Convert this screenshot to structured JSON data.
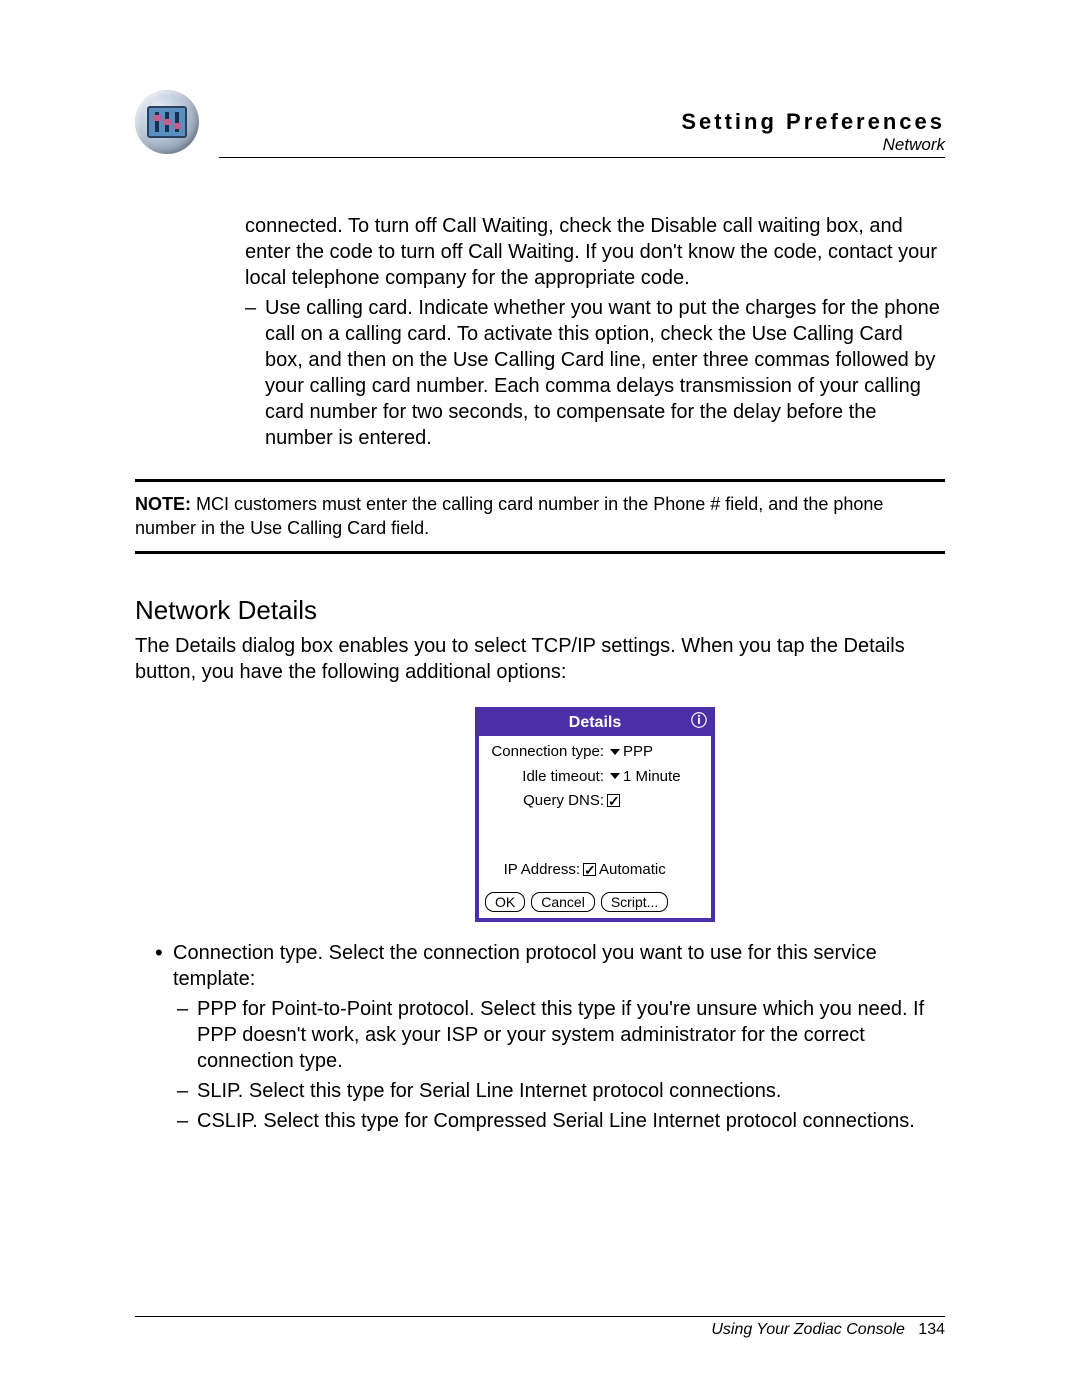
{
  "header": {
    "title": "Setting Preferences",
    "subtitle": "Network"
  },
  "body": {
    "para1": "connected. To turn off Call Waiting, check the Disable call waiting box, and enter the code to turn off Call Waiting. If you don't know the code, contact your local telephone company for the appropriate code.",
    "dash1": "Use calling card. Indicate whether you want to put the charges for the phone call on a calling card. To activate this option, check the Use Calling Card box, and then on the Use Calling Card line, enter three commas followed by your calling card number. Each comma delays transmission of your calling card number for two seconds, to compensate for the delay before the number is entered."
  },
  "note": {
    "label": "NOTE:",
    "text": "MCI customers must enter the calling card number in the Phone # field, and the phone number in the Use Calling Card field."
  },
  "section": {
    "heading": "Network Details",
    "intro": "The Details dialog box enables you to select TCP/IP settings. When you tap the Details button, you have the following additional options:"
  },
  "dialog": {
    "title": "Details",
    "conn_label": "Connection type:",
    "conn_value": "PPP",
    "idle_label": "Idle timeout:",
    "idle_value": "1 Minute",
    "dns_label": "Query DNS:",
    "ip_label": "IP Address:",
    "ip_value": "Automatic",
    "ok": "OK",
    "cancel": "Cancel",
    "script": "Script..."
  },
  "bullets": {
    "b1": "Connection type. Select the connection protocol you want to use for this service template:",
    "s1": "PPP for Point-to-Point protocol. Select this type if you're unsure which you need. If PPP doesn't work, ask your ISP or your system administrator for the correct connection type.",
    "s2": "SLIP. Select this type for Serial Line Internet protocol connections.",
    "s3": "CSLIP. Select this type for Compressed Serial Line Internet protocol connections."
  },
  "footer": {
    "text": "Using Your Zodiac Console",
    "page": "134"
  }
}
